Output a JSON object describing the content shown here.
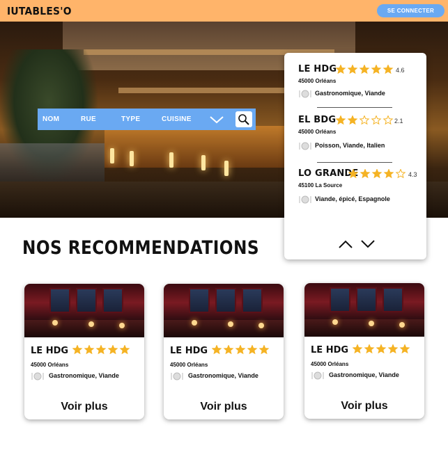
{
  "header": {
    "logo": "IUTABLES'O",
    "connect_label": "SE CONNECTER"
  },
  "search": {
    "fields": [
      "NOM",
      "RUE",
      "TYPE",
      "CUISINE"
    ],
    "dropdown_icon": "chevron-down-icon",
    "search_icon": "search-icon"
  },
  "results": [
    {
      "name": "LE HDG",
      "stars": 5,
      "rating": "4.6",
      "city": "45000 Orléans",
      "tags": "Gastronomique, Viande"
    },
    {
      "name": "EL BDG",
      "stars": 2,
      "rating": "2.1",
      "city": "45000 Orléans",
      "tags": "Poisson, Viande, Italien"
    },
    {
      "name": "LO GRANDE",
      "stars": 4,
      "rating": "4.3",
      "city": "45100  La Source",
      "tags": "Viande, épicé, Espagnole"
    }
  ],
  "recommendations": {
    "title": "NOS RECOMMENDATIONS",
    "cards": [
      {
        "name": "LE HDG",
        "stars": 5,
        "city": "45000 Orléans",
        "tags": "Gastronomique, Viande",
        "more_label": "Voir plus"
      },
      {
        "name": "LE HDG",
        "stars": 5,
        "city": "45000 Orléans",
        "tags": "Gastronomique, Viande",
        "more_label": "Voir plus"
      },
      {
        "name": "LE HDG",
        "stars": 5,
        "city": "45000 Orléans",
        "tags": "Gastronomique, Viande",
        "more_label": "Voir plus"
      }
    ]
  },
  "colors": {
    "header": "#ffb46a",
    "accent_blue": "#6aa9f2",
    "star": "#f5b324"
  }
}
